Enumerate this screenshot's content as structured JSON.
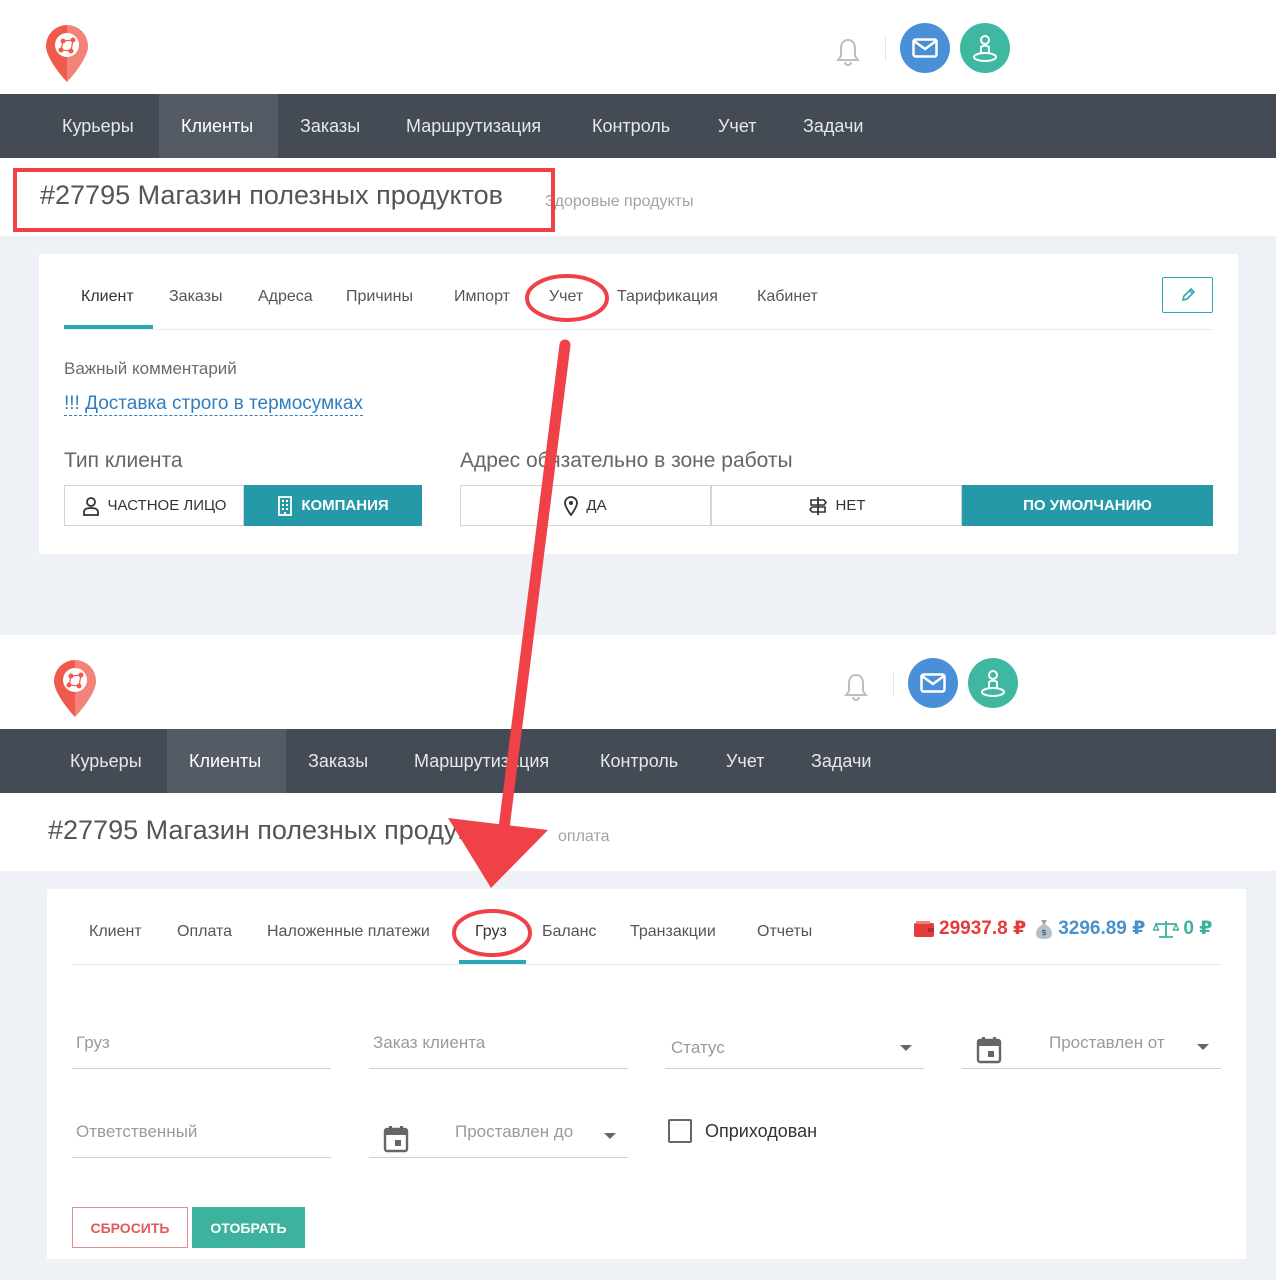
{
  "nav": {
    "items": [
      "Курьеры",
      "Клиенты",
      "Заказы",
      "Маршрутизация",
      "Контроль",
      "Учет",
      "Задачи"
    ],
    "active": "Клиенты"
  },
  "icons": {
    "logo": "map-pin-network-icon",
    "bell": "bell-icon",
    "mail": "envelope-icon",
    "user": "user-location-icon",
    "edit": "pencil-icon",
    "person": "person-icon",
    "building": "building-icon",
    "pin": "map-pin-icon",
    "signpost": "signpost-icon",
    "wallet": "wallet-icon",
    "moneybag": "money-bag-icon",
    "scales": "scales-icon",
    "calendar": "calendar-icon"
  },
  "colors": {
    "accent": "#2aa7b5",
    "nav_bg": "#454b55",
    "annotation": "#f04048",
    "red_balance": "#e23c3c",
    "blue_balance": "#4a90c9",
    "green_balance": "#3db39e"
  },
  "top": {
    "title": "#27795 Магазин полезных продуктов",
    "subtitle": "Здоровые продукты",
    "tabs": [
      "Клиент",
      "Заказы",
      "Адреса",
      "Причины",
      "Импорт",
      "Учет",
      "Тарификация",
      "Кабинет"
    ],
    "active_tab": "Клиент",
    "comment_label": "Важный комментарий",
    "comment_value": "!!! Доставка строго в термосумках",
    "client_type_label": "Тип клиента",
    "client_type_options": [
      "ЧАСТНОЕ ЛИЦО",
      "КОМПАНИЯ"
    ],
    "client_type_selected": "КОМПАНИЯ",
    "zone_label": "Адрес обязательно в зоне работы",
    "zone_options": [
      "ДА",
      "НЕТ",
      "ПО УМОЛЧАНИЮ"
    ],
    "zone_selected": "ПО УМОЛЧАНИЮ"
  },
  "bottom": {
    "title": "#27795 Магазин полезных продуктов",
    "subtitle": "оплата",
    "tabs": [
      "Клиент",
      "Оплата",
      "Наложенные платежи",
      "Груз",
      "Баланс",
      "Транзакции",
      "Отчеты"
    ],
    "active_tab": "Груз",
    "balances": {
      "red": "29937.8 ₽",
      "blue": "3296.89 ₽",
      "green": "0 ₽"
    },
    "filters": {
      "cargo": "Груз",
      "client_order": "Заказ клиента",
      "status": "Статус",
      "placed_from": "Проставлен от",
      "responsible": "Ответственный",
      "placed_to": "Проставлен до",
      "posted": "Оприходован"
    },
    "reset_label": "СБРОСИТЬ",
    "apply_label": "ОТОБРАТЬ"
  }
}
